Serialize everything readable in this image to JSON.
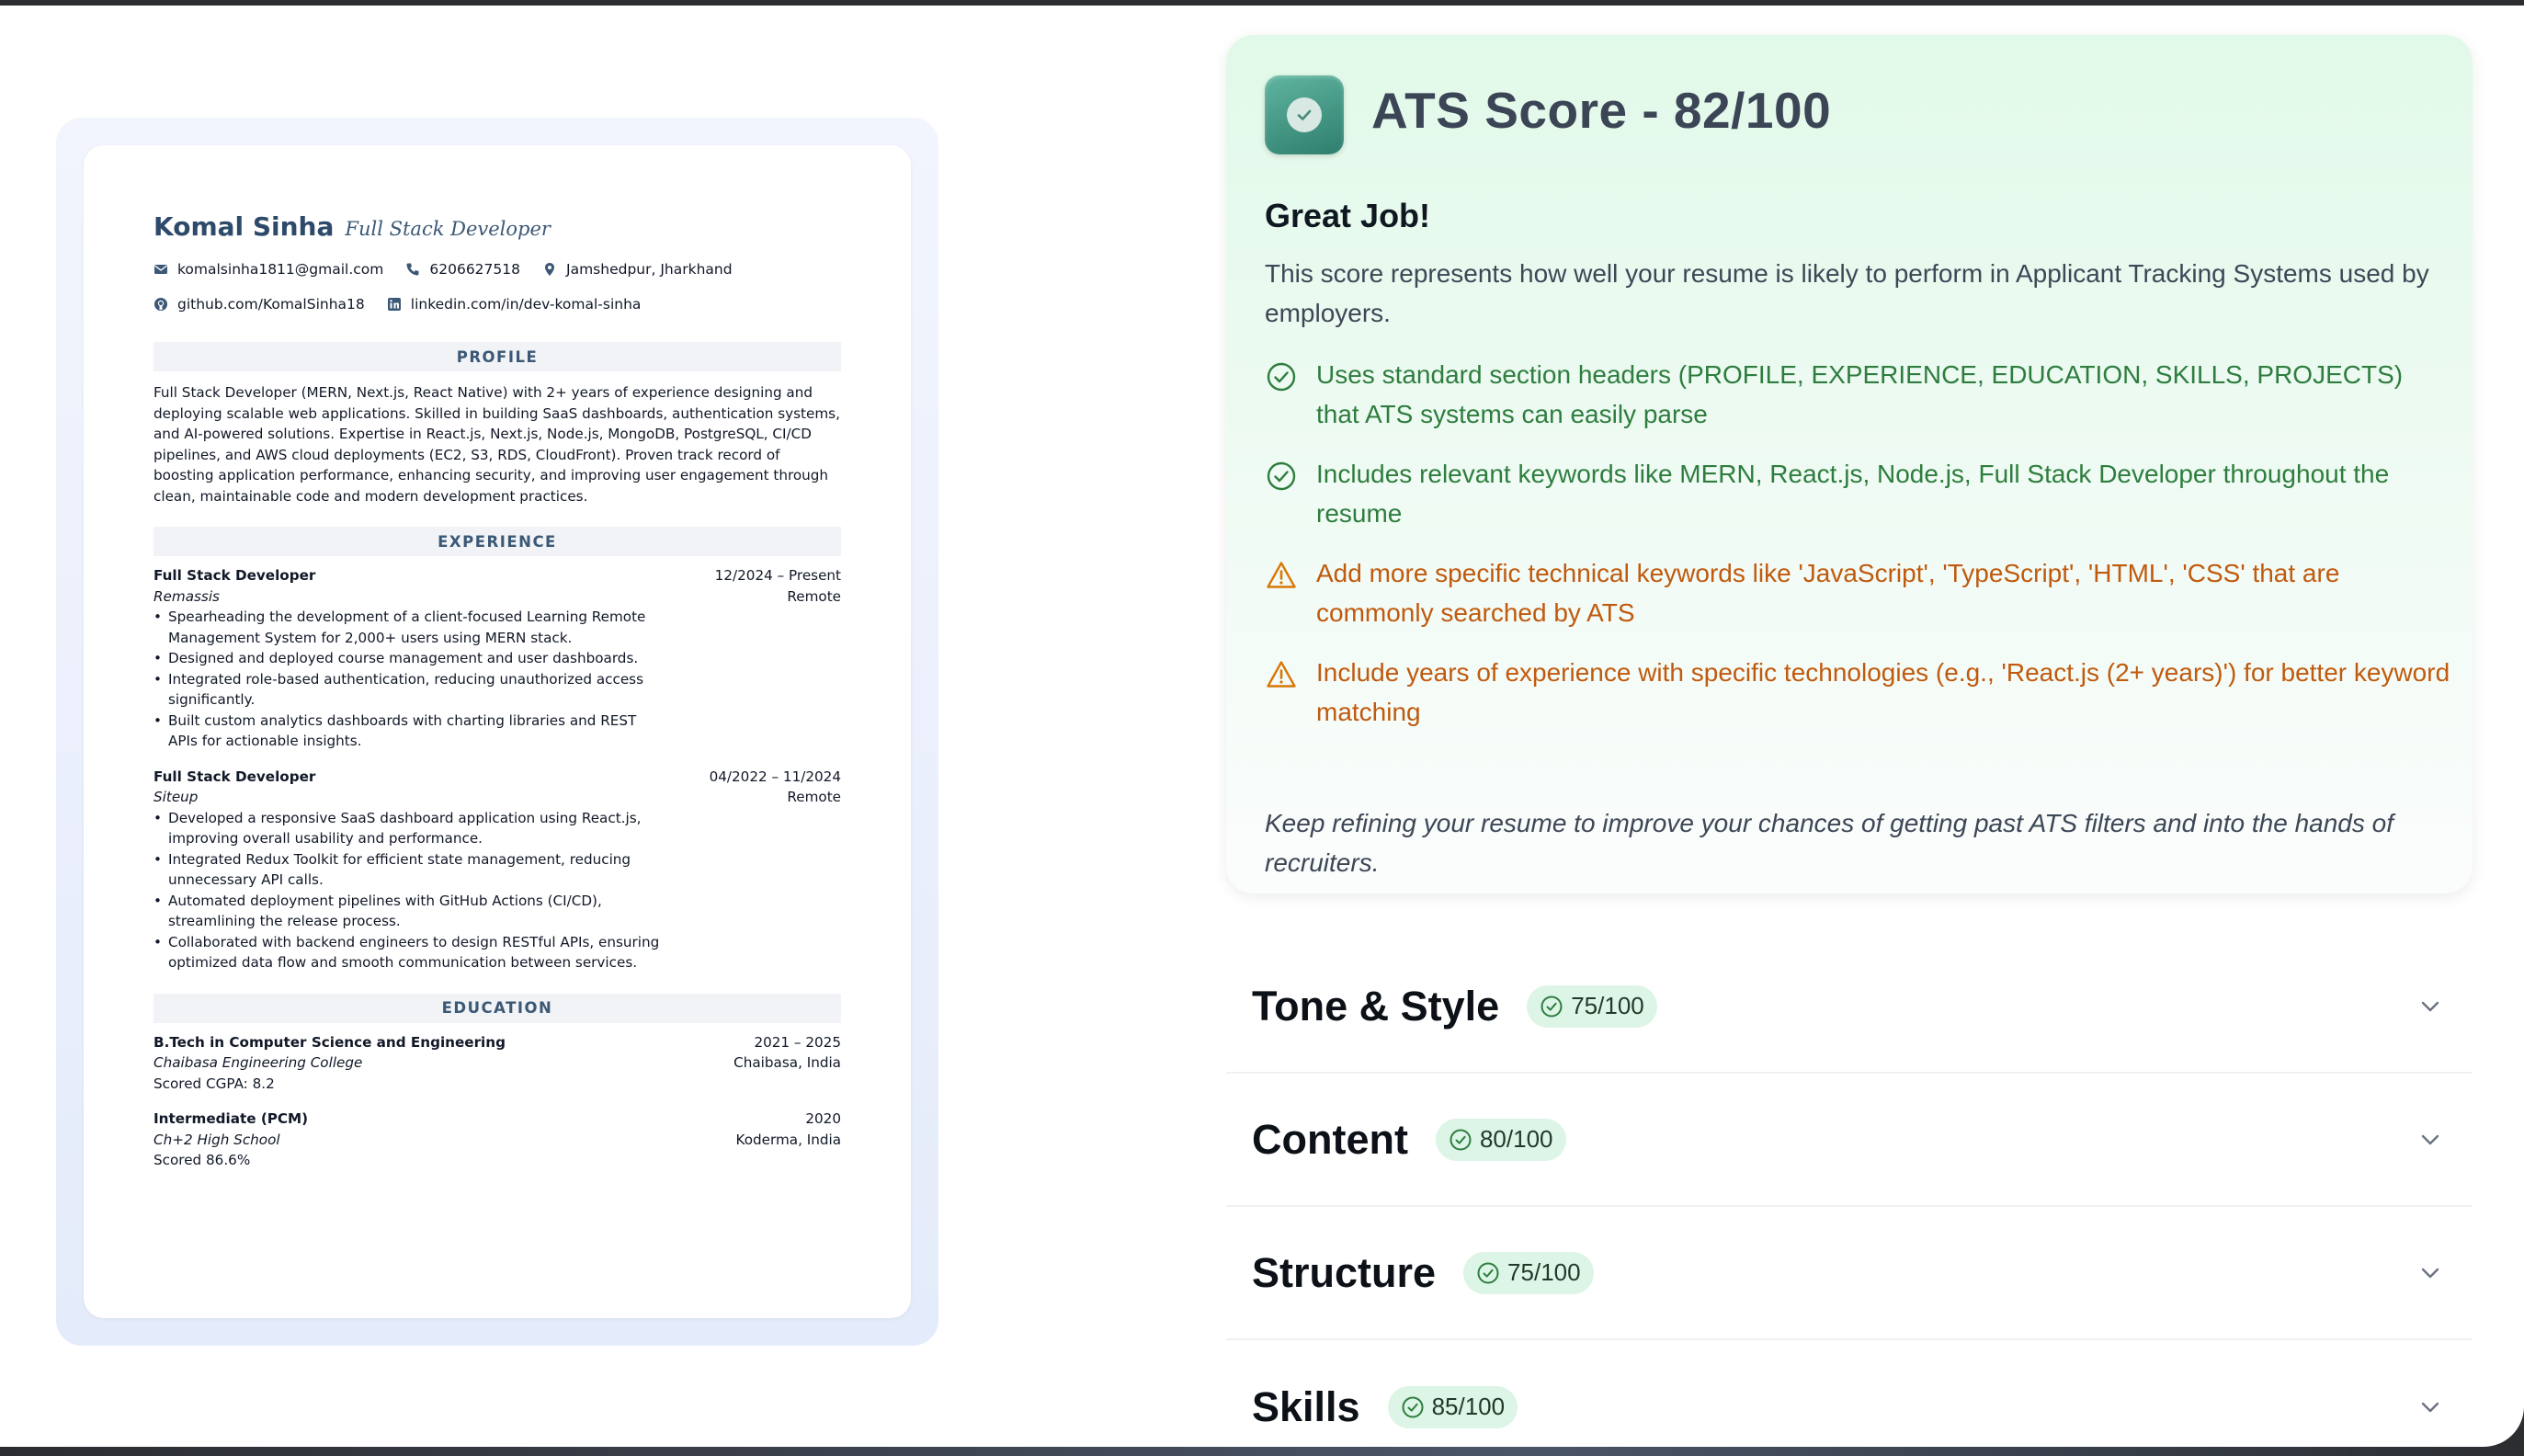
{
  "resume": {
    "name": "Komal Sinha",
    "role": "Full Stack Developer",
    "contacts": [
      {
        "icon": "mail-icon",
        "text": "komalsinha1811@gmail.com"
      },
      {
        "icon": "phone-icon",
        "text": "6206627518"
      },
      {
        "icon": "location-icon",
        "text": "Jamshedpur, Jharkhand"
      }
    ],
    "links": [
      {
        "icon": "github-icon",
        "text": "github.com/KomalSinha18"
      },
      {
        "icon": "linkedin-icon",
        "text": "linkedin.com/in/dev-komal-sinha"
      }
    ],
    "profile_heading": "PROFILE",
    "profile_text": "Full Stack Developer (MERN, Next.js, React Native) with 2+ years of experience designing and deploying scalable web applications. Skilled in building SaaS dashboards, authentication systems, and AI-powered solutions. Expertise in React.js, Next.js, Node.js, MongoDB, PostgreSQL, CI/CD pipelines, and AWS cloud deployments (EC2, S3, RDS, CloudFront). Proven track record of boosting application performance, enhancing security, and improving user engagement through clean, maintainable code and modern development practices.",
    "experience_heading": "EXPERIENCE",
    "jobs": [
      {
        "title": "Full Stack Developer",
        "dates": "12/2024 – Present",
        "company": "Remassis",
        "location": "Remote",
        "bullets": [
          "Spearheading the development of a client-focused Learning Remote Management System for 2,000+ users using MERN stack.",
          "Designed and deployed course management and user dashboards.",
          "Integrated role-based authentication, reducing unauthorized access significantly.",
          "Built custom analytics dashboards with charting libraries and REST APIs for actionable insights."
        ]
      },
      {
        "title": "Full Stack Developer",
        "dates": "04/2022 – 11/2024",
        "company": "Siteup",
        "location": "Remote",
        "bullets": [
          "Developed a responsive SaaS dashboard application using React.js, improving overall usability and performance.",
          "Integrated Redux Toolkit for efficient state management, reducing unnecessary API calls.",
          "Automated deployment pipelines with GitHub Actions (CI/CD), streamlining the release process.",
          "Collaborated with backend engineers to design RESTful APIs, ensuring optimized data flow and smooth communication between services."
        ]
      }
    ],
    "education_heading": "EDUCATION",
    "education": [
      {
        "degree": "B.Tech in Computer Science and Engineering",
        "years": "2021 – 2025",
        "school": "Chaibasa Engineering College",
        "location": "Chaibasa, India",
        "score": "Scored CGPA: 8.2"
      },
      {
        "degree": "Intermediate (PCM)",
        "years": "2020",
        "school": "Ch+2 High School",
        "location": "Koderma, India",
        "score": "Scored 86.6%"
      }
    ]
  },
  "ats": {
    "title": "ATS Score - 82/100",
    "subtitle": "Great Job!",
    "description": "This score represents how well your resume is likely to perform in Applicant Tracking Systems used by employers.",
    "tips": [
      {
        "type": "good",
        "icon": "check-circle-icon",
        "text": "Uses standard section headers (PROFILE, EXPERIENCE, EDUCATION, SKILLS, PROJECTS) that ATS systems can easily parse"
      },
      {
        "type": "good",
        "icon": "check-circle-icon",
        "text": "Includes relevant keywords like MERN, React.js, Node.js, Full Stack Developer throughout the resume"
      },
      {
        "type": "warn",
        "icon": "warning-triangle-icon",
        "text": "Add more specific technical keywords like 'JavaScript', 'TypeScript', 'HTML', 'CSS' that are commonly searched by ATS"
      },
      {
        "type": "warn",
        "icon": "warning-triangle-icon",
        "text": "Include years of experience with specific technologies (e.g., 'React.js (2+ years)') for better keyword matching"
      }
    ],
    "footer": "Keep refining your resume to improve your chances of getting past ATS filters and into the hands of recruiters."
  },
  "categories": [
    {
      "title": "Tone & Style",
      "score": "75/100"
    },
    {
      "title": "Content",
      "score": "80/100"
    },
    {
      "title": "Structure",
      "score": "75/100"
    },
    {
      "title": "Skills",
      "score": "85/100"
    }
  ],
  "colors": {
    "good": "#2e7d3e",
    "warn": "#c05a0e",
    "resume_accent": "#2e4a6b",
    "card_bg": "#e1f9e9",
    "badge_bg": "#dcf5e6"
  }
}
